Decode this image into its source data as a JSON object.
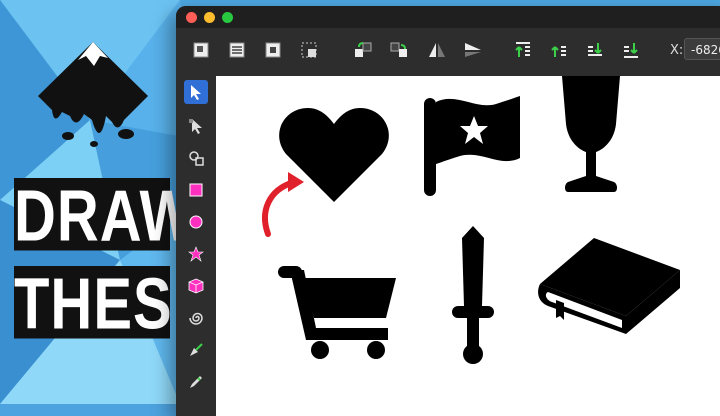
{
  "headline": {
    "line1": "DRAW",
    "line2": "THESE"
  },
  "toolbar": {
    "x_label": "X:",
    "x_value": "-6826"
  },
  "colors": {
    "accent": "#2f6fd6",
    "arrow": "#e0202a",
    "panel": "#2d2d2d",
    "canvas": "#ffffff"
  },
  "icons": {
    "toolbar": [
      "select-all-icon",
      "select-all-layers-icon",
      "deselect-icon",
      "select-same-icon",
      "rotate-ccw-icon",
      "rotate-cw-icon",
      "flip-horizontal-icon",
      "flip-vertical-icon",
      "raise-to-top-icon",
      "raise-icon",
      "lower-icon",
      "lower-to-bottom-icon"
    ],
    "tools": [
      "selector-icon",
      "node-icon",
      "tweak-icon",
      "rectangle-icon",
      "circle-icon",
      "star-icon",
      "3d-box-icon",
      "spiral-icon",
      "pen-icon",
      "pencil-icon"
    ],
    "canvas": [
      "heart-icon",
      "flag-icon",
      "goblet-icon",
      "shopping-cart-icon",
      "sword-icon",
      "book-icon"
    ]
  }
}
